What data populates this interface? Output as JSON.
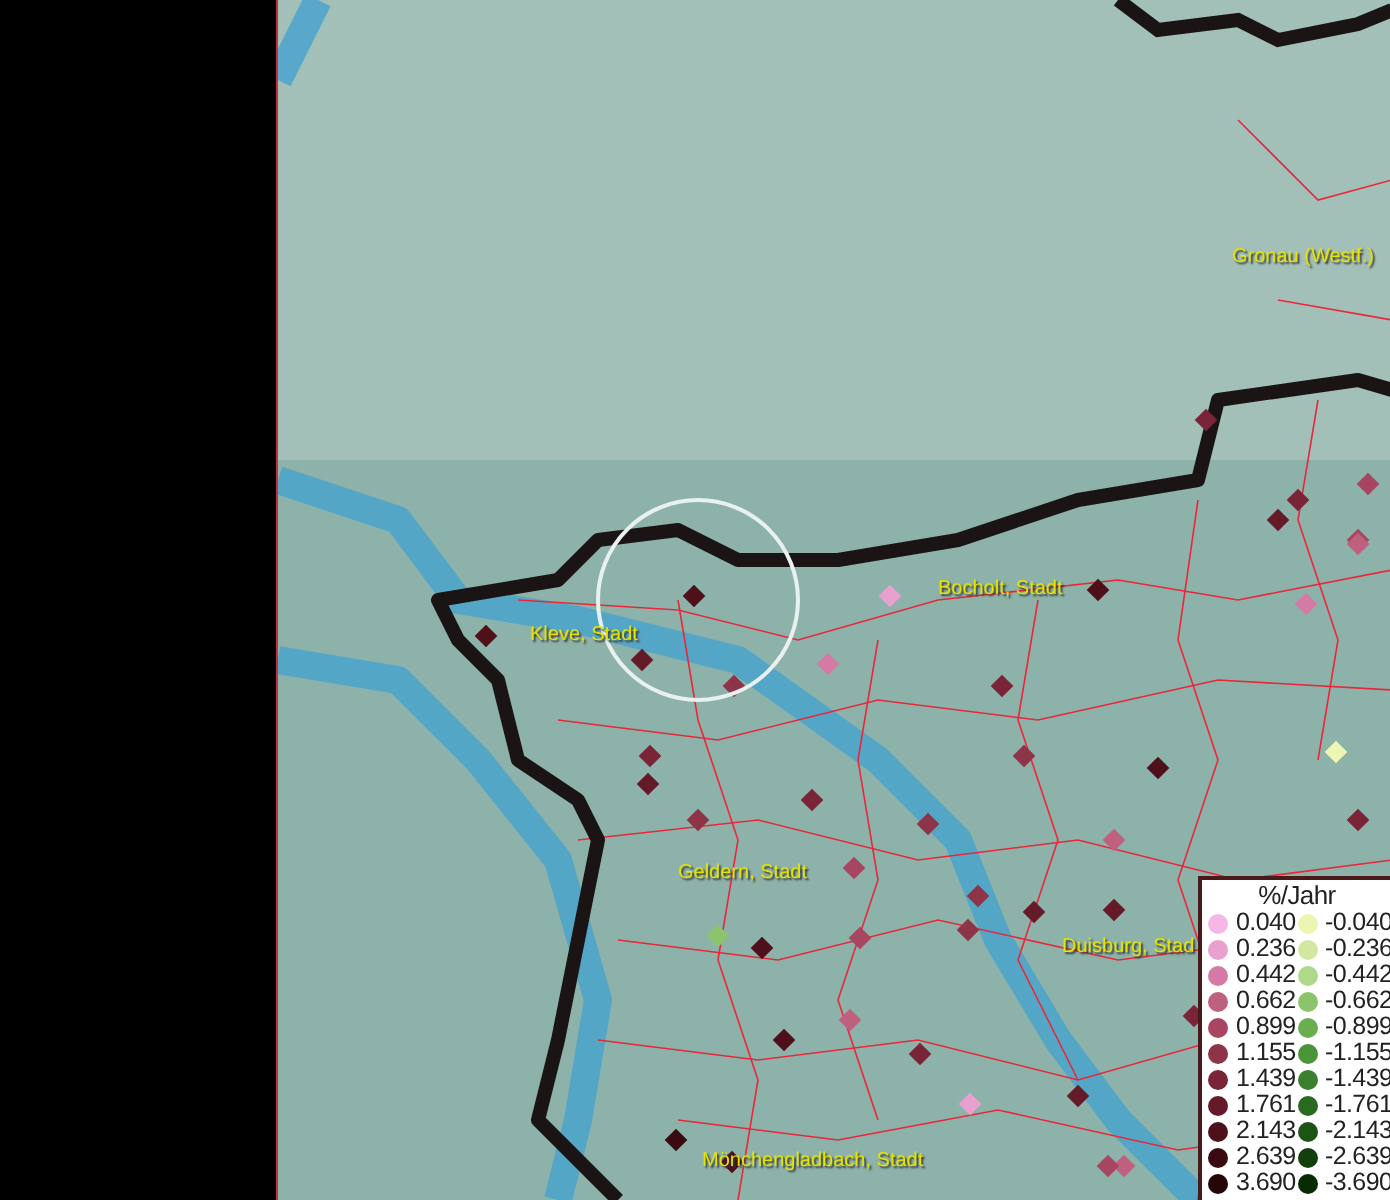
{
  "map": {
    "places": [
      {
        "name": "Gronau (Westf.)"
      },
      {
        "name": "Bocholt, Stadt"
      },
      {
        "name": "Kleve, Stadt"
      },
      {
        "name": "Geldern, Stadt"
      },
      {
        "name": "Duisburg, Stad"
      },
      {
        "name": "Mönchengladbach, Stadt"
      }
    ]
  },
  "legend": {
    "title": "%/Jahr",
    "rows": [
      {
        "positive": {
          "value": "0.040",
          "color": "#f5b8e6"
        },
        "negative": {
          "value": "-0.040",
          "color": "#eef5b0"
        }
      },
      {
        "positive": {
          "value": "0.236",
          "color": "#e8a0cf"
        },
        "negative": {
          "value": "-0.236",
          "color": "#d2e8a0"
        }
      },
      {
        "positive": {
          "value": "0.442",
          "color": "#d47aa5"
        },
        "negative": {
          "value": "-0.442",
          "color": "#b0d88a"
        }
      },
      {
        "positive": {
          "value": "0.662",
          "color": "#c0607f"
        },
        "negative": {
          "value": "-0.662",
          "color": "#8cc46c"
        }
      },
      {
        "positive": {
          "value": "0.899",
          "color": "#a84560"
        },
        "negative": {
          "value": "-0.899",
          "color": "#6aae50"
        }
      },
      {
        "positive": {
          "value": "1.155",
          "color": "#8e3448"
        },
        "negative": {
          "value": "-1.155",
          "color": "#4a943a"
        }
      },
      {
        "positive": {
          "value": "1.439",
          "color": "#7a2537"
        },
        "negative": {
          "value": "-1.439",
          "color": "#3a802e"
        }
      },
      {
        "positive": {
          "value": "1.761",
          "color": "#651a28"
        },
        "negative": {
          "value": "-1.761",
          "color": "#2a6a20"
        }
      },
      {
        "positive": {
          "value": "2.143",
          "color": "#4e1019"
        },
        "negative": {
          "value": "-2.143",
          "color": "#1c5414"
        }
      },
      {
        "positive": {
          "value": "2.639",
          "color": "#3a0a10"
        },
        "negative": {
          "value": "-2.639",
          "color": "#12400c"
        }
      },
      {
        "positive": {
          "value": "3.690",
          "color": "#250508"
        },
        "negative": {
          "value": "-3.690",
          "color": "#0a2a06"
        }
      }
    ]
  }
}
